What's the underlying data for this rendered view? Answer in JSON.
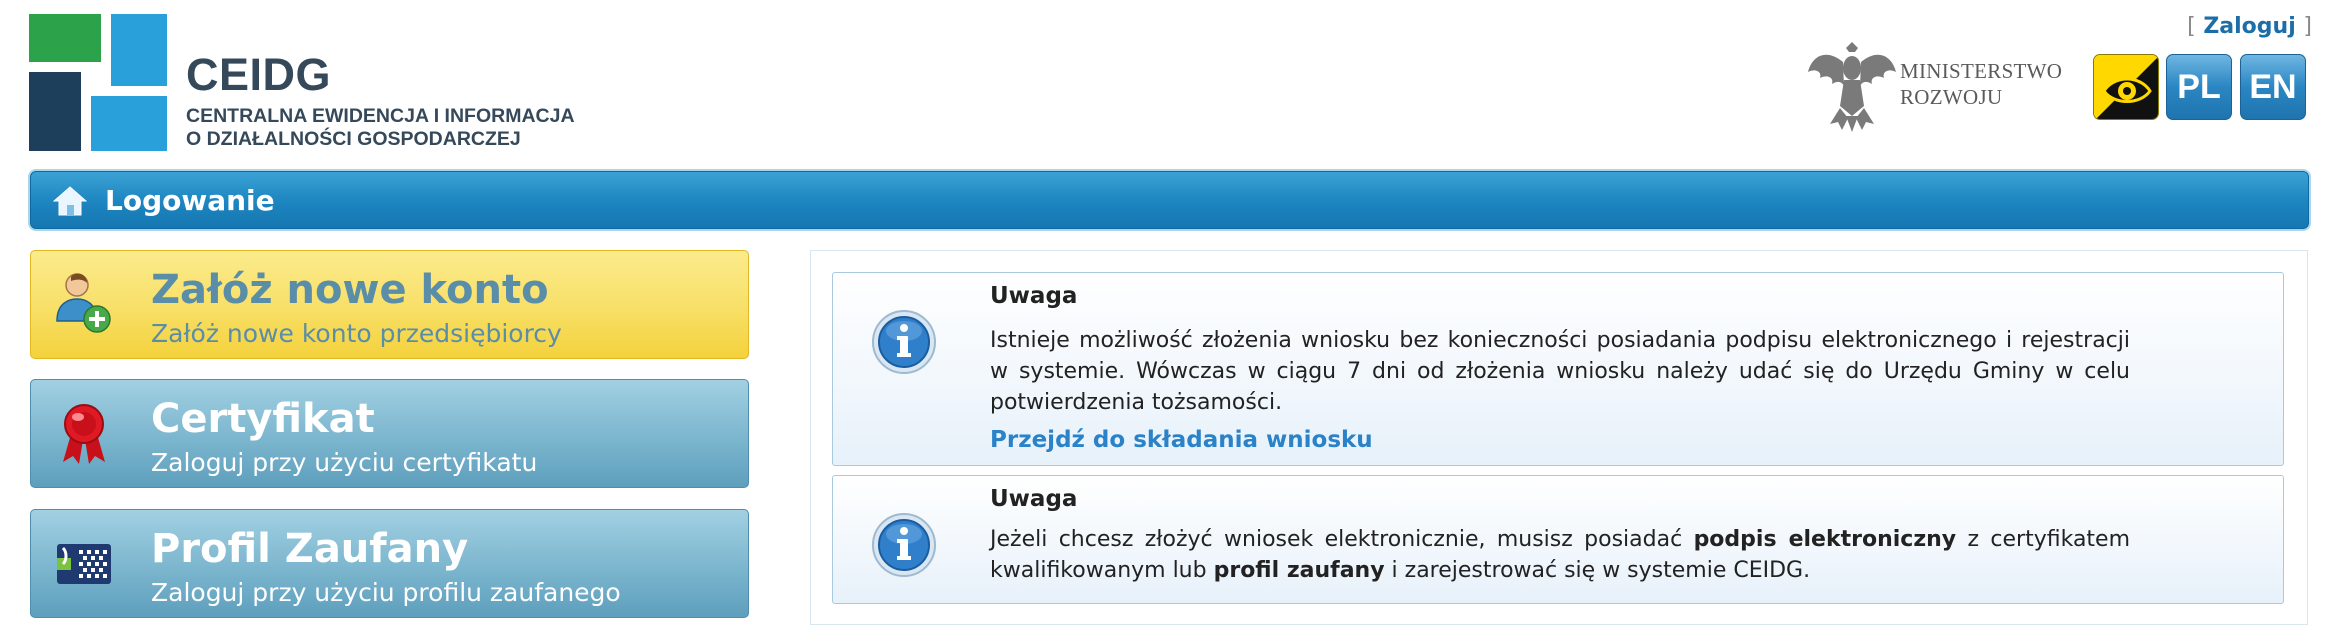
{
  "header": {
    "logo_title": "CEIDG",
    "logo_subtitle_line1": "CENTRALNA EWIDENCJA I INFORMACJA",
    "logo_subtitle_line2": "O DZIAŁALNOŚCI GOSPODARCZEJ",
    "login_bracket_open": "[",
    "login_label": "Zaloguj",
    "login_bracket_close": "]",
    "ministry_line1": "MINISTERSTWO",
    "ministry_line2": "ROZWOJU",
    "lang_pl": "PL",
    "lang_en": "EN"
  },
  "titlebar": {
    "title": "Logowanie"
  },
  "menu": [
    {
      "title": "Załóż nowe konto",
      "subtitle": "Załóż nowe konto przedsiębiorcy",
      "icon": "user-add-icon"
    },
    {
      "title": "Certyfikat",
      "subtitle": "Zaloguj przy użyciu certyfikatu",
      "icon": "certificate-ribbon-icon"
    },
    {
      "title": "Profil Zaufany",
      "subtitle": "Zaloguj przy użyciu profilu zaufanego",
      "icon": "trusted-profile-icon"
    }
  ],
  "notices": [
    {
      "heading": "Uwaga",
      "body": "Istnieje możliwość złożenia wniosku bez konieczności posiadania podpisu elektronicznego i rejestracji w systemie. Wówczas w ciągu 7 dni od złożenia wniosku należy udać się do Urzędu Gminy w celu potwierdzenia tożsamości.",
      "link": "Przejdź do składania wniosku"
    },
    {
      "heading": "Uwaga",
      "body_part1": "Jeżeli chcesz złożyć wniosek elektronicznie, musisz posiadać ",
      "body_bold1": "podpis elektroniczny",
      "body_part2": " z certyfikatem kwalifikowanym lub ",
      "body_bold2": "profil zaufany",
      "body_part3": " i zarejestrować się w systemie CEIDG."
    }
  ],
  "colors": {
    "titlebar": "#1c84bf",
    "new_account_button": "#f8e06a",
    "login_buttons": "#7fb8d0",
    "link": "#2a82c8"
  }
}
